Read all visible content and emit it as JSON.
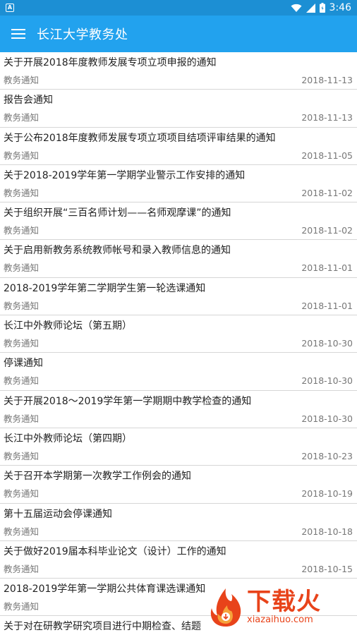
{
  "status_bar": {
    "notification_icon": "A",
    "time": "3:46"
  },
  "app_bar": {
    "title": "长江大学教务处"
  },
  "items": [
    {
      "title": "关于开展2018年度教师发展专项立项申报的通知",
      "category": "教务通知",
      "date": "2018-11-13"
    },
    {
      "title": "报告会通知",
      "category": "教务通知",
      "date": "2018-11-13"
    },
    {
      "title": "关于公布2018年度教师发展专项立项项目结项评审结果的通知",
      "category": "教务通知",
      "date": "2018-11-05"
    },
    {
      "title": "关于2018-2019学年第一学期学业警示工作安排的通知",
      "category": "教务通知",
      "date": "2018-11-02"
    },
    {
      "title": "关于组织开展“三百名师计划——名师观摩课”的通知",
      "category": "教务通知",
      "date": "2018-11-02"
    },
    {
      "title": "关于启用新教务系统教师帐号和录入教师信息的通知",
      "category": "教务通知",
      "date": "2018-11-01"
    },
    {
      "title": "2018-2019学年第二学期学生第一轮选课通知",
      "category": "教务通知",
      "date": "2018-11-01"
    },
    {
      "title": "长江中外教师论坛（第五期）",
      "category": "教务通知",
      "date": "2018-10-30"
    },
    {
      "title": "停课通知",
      "category": "教务通知",
      "date": "2018-10-30"
    },
    {
      "title": "关于开展2018～2019学年第一学期期中教学检查的通知",
      "category": "教务通知",
      "date": "2018-10-30"
    },
    {
      "title": "长江中外教师论坛（第四期）",
      "category": "教务通知",
      "date": "2018-10-23"
    },
    {
      "title": "关于召开本学期第一次教学工作例会的通知",
      "category": "教务通知",
      "date": "2018-10-19"
    },
    {
      "title": "第十五届运动会停课通知",
      "category": "教务通知",
      "date": "2018-10-18"
    },
    {
      "title": "关于做好2019届本科毕业论文（设计）工作的通知",
      "category": "教务通知",
      "date": "2018-10-15"
    },
    {
      "title": "2018-2019学年第一学期公共体育课选课通知",
      "category": "教务通知",
      "date": ""
    },
    {
      "title": "关于对在研教学研究项目进行中期检查、结题",
      "category": "",
      "date": ""
    }
  ],
  "watermark": {
    "text": "下载火",
    "url": "xiazaihuo.com"
  },
  "colors": {
    "status_bar": "#1c8fd4",
    "app_bar": "#22a2ee",
    "watermark": "#e8431a"
  }
}
